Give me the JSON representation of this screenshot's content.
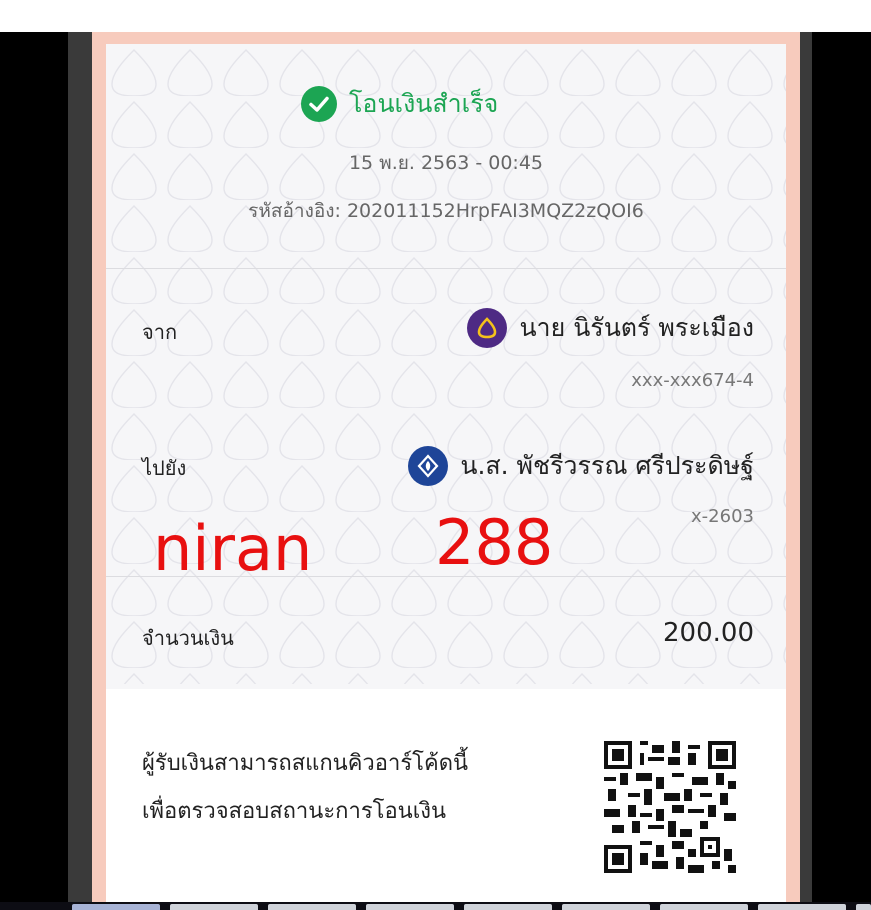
{
  "receipt": {
    "status": "โอนเงินสำเร็จ",
    "datetime": "15 พ.ย. 2563 - 00:45",
    "reference": "รหัสอ้างอิง: 202011152HrpFAI3MQZ2zQOI6",
    "from": {
      "label": "จาก",
      "name": "นาย นิรันตร์ พระเมือง",
      "account": "xxx-xxx674-4",
      "bank_icon": "scb-bank-icon",
      "bank_color": "#4e2a84"
    },
    "to": {
      "label": "ไปยัง",
      "name": "น.ส. พัชรีวรรณ ศรีประดิษฐ์",
      "account": "x-2603",
      "bank_icon": "bbl-bank-icon",
      "bank_color": "#1e4598"
    },
    "amount_label": "จำนวนเงิน",
    "amount": "200.00",
    "qr_note_line1": "ผู้รับเงินสามารถสแกนคิวอาร์โค้ดนี้",
    "qr_note_line2": "เพื่อตรวจสอบสถานะการโอนเงิน",
    "qr_icon": "qr-code-icon",
    "success_color": "#1ca553"
  },
  "overlay": {
    "name": "niran",
    "number": "288",
    "color": "#e81010"
  }
}
